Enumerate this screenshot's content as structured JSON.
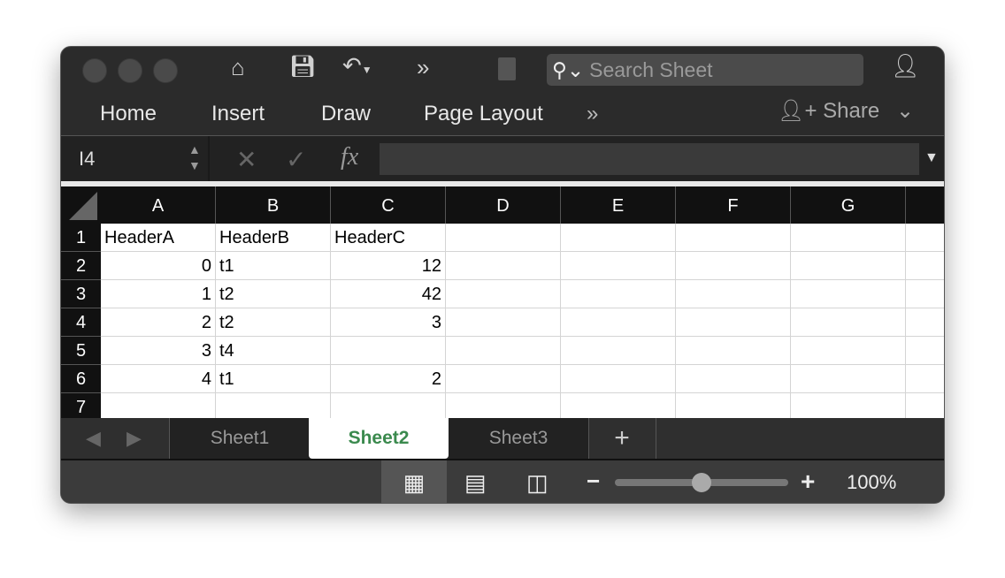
{
  "toolbar": {
    "search_placeholder": "Search Sheet"
  },
  "ribbon": {
    "tabs": [
      "Home",
      "Insert",
      "Draw",
      "Page Layout"
    ],
    "more": "»",
    "share": "Share"
  },
  "formula_bar": {
    "name_box": "I4",
    "fx": "fx",
    "value": ""
  },
  "columns": [
    "A",
    "B",
    "C",
    "D",
    "E",
    "F",
    "G"
  ],
  "rows": [
    {
      "n": "1",
      "cells": [
        "HeaderA",
        "HeaderB",
        "HeaderC"
      ]
    },
    {
      "n": "2",
      "cells": [
        "0",
        "t1",
        "12"
      ]
    },
    {
      "n": "3",
      "cells": [
        "1",
        "t2",
        "42"
      ]
    },
    {
      "n": "4",
      "cells": [
        "2",
        "t2",
        "3"
      ]
    },
    {
      "n": "5",
      "cells": [
        "3",
        "t4",
        ""
      ]
    },
    {
      "n": "6",
      "cells": [
        "4",
        "t1",
        "2"
      ]
    },
    {
      "n": "7",
      "cells": [
        "",
        "",
        ""
      ]
    }
  ],
  "sheets": [
    {
      "label": "Sheet1"
    },
    {
      "label": "Sheet2",
      "active": true
    },
    {
      "label": "Sheet3"
    }
  ],
  "status": {
    "zoom": "100%",
    "zoom_fraction": 0.5
  },
  "colors": {
    "active_tab": "#3b8a4e",
    "chrome": "#2b2b2b"
  }
}
